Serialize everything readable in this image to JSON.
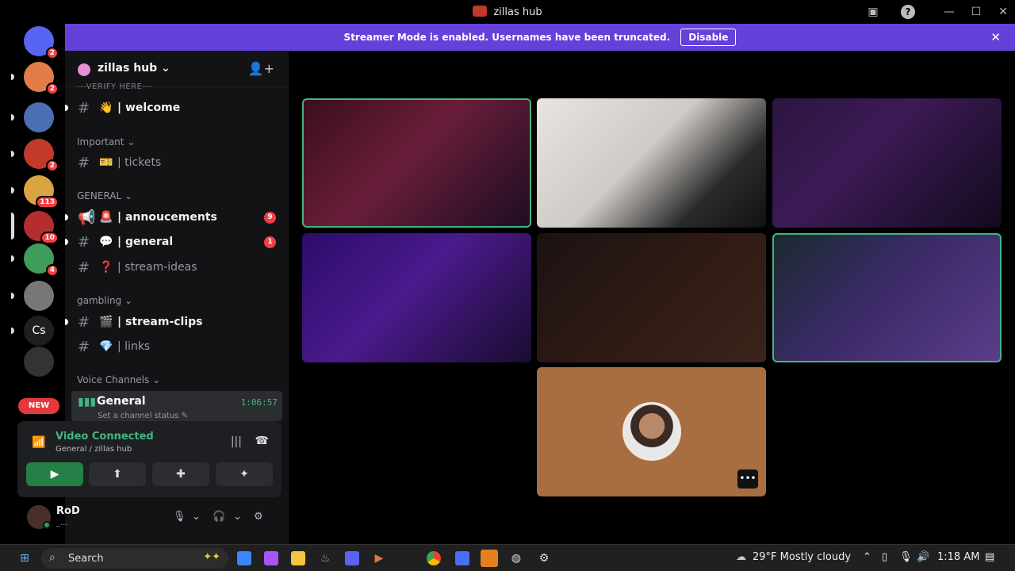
{
  "window": {
    "title": "zillas hub",
    "icons": [
      "discord-logo",
      "notification-icon",
      "help-icon",
      "minimize-icon",
      "maximize-icon",
      "close-icon"
    ]
  },
  "guilds": [
    {
      "name": "direct-messages",
      "badge": "2",
      "color": "#5865f2"
    },
    {
      "name": "server-1",
      "badge": "2",
      "color": "#e27d4a"
    },
    {
      "name": "server-2",
      "badge": "",
      "color": "#4a6fb2"
    },
    {
      "name": "server-3",
      "badge": "2",
      "color": "#c23a2b"
    },
    {
      "name": "server-4",
      "badge": "113",
      "color": "#d9a441"
    },
    {
      "name": "zillas-hub",
      "badge": "10",
      "color": "#b52e2e"
    },
    {
      "name": "server-6",
      "badge": "4",
      "color": "#3f9d5c"
    },
    {
      "name": "server-7",
      "badge": "",
      "color": "#777"
    },
    {
      "name": "cs-server",
      "badge": "",
      "label": "Cs",
      "color": "#1f1f1f"
    },
    {
      "name": "server-9",
      "badge": "",
      "color": "#333"
    }
  ],
  "new_label": "NEW",
  "streamer_banner": {
    "message": "Streamer Mode is enabled. Usernames have been truncated.",
    "button": "Disable"
  },
  "server": {
    "name": "zillas hub",
    "cut_category": "---VERIFY HERE---",
    "categories": [
      {
        "label": "Important"
      },
      {
        "label": "GENERAL"
      },
      {
        "label": "gambling"
      },
      {
        "label": "Voice Channels"
      }
    ],
    "channels": [
      {
        "emoji": "👋",
        "label": "| welcome",
        "bold": true,
        "unread": true,
        "count": ""
      },
      {
        "emoji": "🎫",
        "label": "| tickets",
        "bold": false,
        "unread": false,
        "count": ""
      },
      {
        "emoji": "🚨",
        "label": "| annoucements",
        "bold": true,
        "unread": true,
        "count": "9"
      },
      {
        "emoji": "💬",
        "label": "| general",
        "bold": true,
        "unread": true,
        "count": "1"
      },
      {
        "emoji": "❓",
        "label": "| stream-ideas",
        "bold": false,
        "unread": false,
        "count": ""
      },
      {
        "emoji": "🎬",
        "label": "| stream-clips",
        "bold": true,
        "unread": true,
        "count": ""
      },
      {
        "emoji": "💎",
        "label": "| links",
        "bold": false,
        "unread": false,
        "count": ""
      }
    ],
    "voice_channel": {
      "name": "General",
      "time": "1:06:57",
      "status": "Set a channel status"
    }
  },
  "voice_panel": {
    "state": "Video Connected",
    "location": "General / zillas hub"
  },
  "user": {
    "name": "RoD",
    "subtitle": "_..."
  },
  "tiles": [
    {
      "name": "participant-1",
      "speaking": true
    },
    {
      "name": "participant-2",
      "speaking": false
    },
    {
      "name": "participant-3",
      "speaking": false
    },
    {
      "name": "participant-4",
      "speaking": false
    },
    {
      "name": "participant-5",
      "speaking": false
    },
    {
      "name": "participant-6",
      "speaking": true
    },
    {
      "name": "participant-7",
      "speaking": false,
      "avatar_only": true,
      "color": "#a86d40"
    }
  ],
  "taskbar": {
    "search_label": "Search",
    "weather": "29°F  Mostly cloudy",
    "time": "1:18 AM"
  }
}
